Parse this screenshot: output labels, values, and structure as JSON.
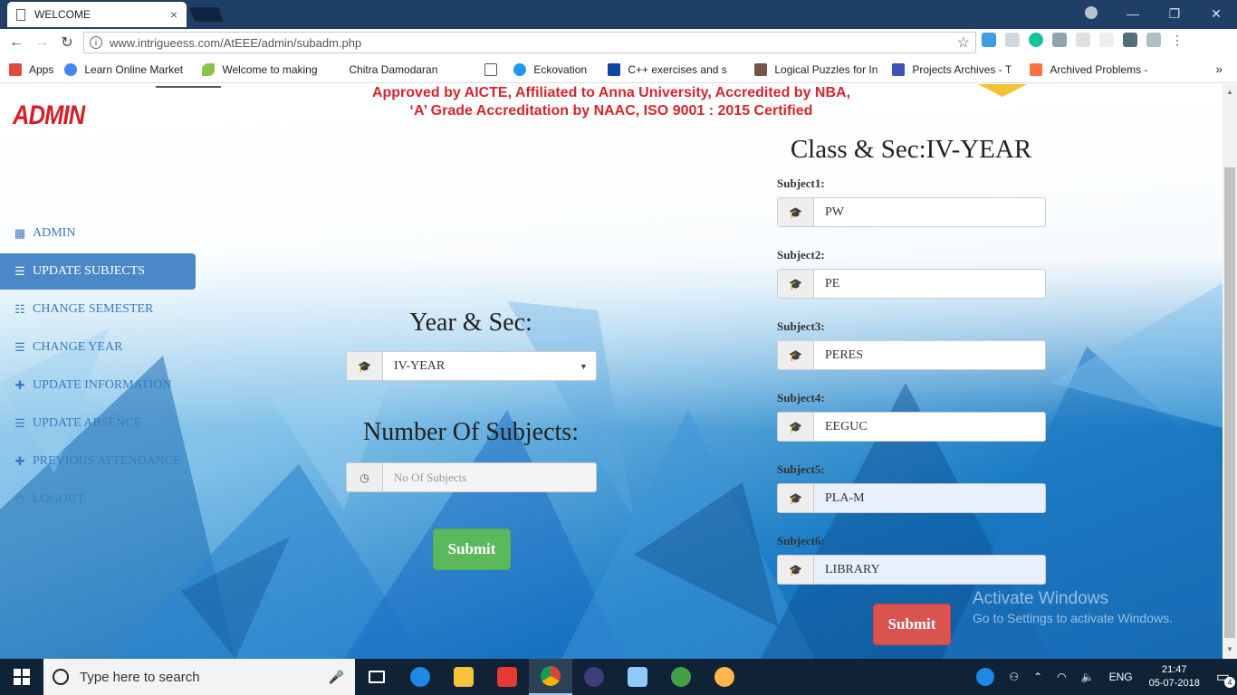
{
  "browser": {
    "tab_title": "WELCOME",
    "tab_close": "×",
    "url": "www.intrigueess.com/AtEEE/admin/subadm.php",
    "window_controls": [
      "—",
      "❐",
      "✕"
    ],
    "bookmarks_more": "»",
    "bookmarks": [
      {
        "label": "Apps",
        "color": "#e04a3a"
      },
      {
        "label": "Learn Online Market",
        "color": "#4285f4"
      },
      {
        "label": "Welcome to making",
        "color": "#8bc34a"
      },
      {
        "label": "Chitra Damodaran",
        "color": "#ffffff"
      },
      {
        "label": "",
        "color": "#ffffff"
      },
      {
        "label": "Eckovation",
        "color": "#2196f3"
      },
      {
        "label": "C++ exercises and s",
        "color": "#0d47a1"
      },
      {
        "label": "Logical Puzzles for In",
        "color": "#795548"
      },
      {
        "label": "Projects Archives - T",
        "color": "#3f51b5"
      },
      {
        "label": "Archived Problems -",
        "color": "#ff7043"
      }
    ]
  },
  "page": {
    "banner_line1": "Approved by AICTE, Affiliated to Anna University, Accredited by NBA,",
    "banner_line2": "‘A’ Grade Accreditation by NAAC, ISO 9001 : 2015 Certified",
    "admin_title": "ADMIN",
    "sidebar": [
      {
        "label": "ADMIN",
        "icon": "calendar-icon",
        "glyph": "▦",
        "active": false
      },
      {
        "label": "UPDATE SUBJECTS",
        "icon": "list-icon",
        "glyph": "☰",
        "active": true
      },
      {
        "label": "CHANGE SEMESTER",
        "icon": "list-icon",
        "glyph": "☷",
        "active": false
      },
      {
        "label": "CHANGE YEAR",
        "icon": "list-icon",
        "glyph": "☰",
        "active": false
      },
      {
        "label": "UPDATE INFORMATION",
        "icon": "plus-icon",
        "glyph": "✚",
        "active": false
      },
      {
        "label": "UPDATE ABSENCE",
        "icon": "list-icon",
        "glyph": "☰",
        "active": false
      },
      {
        "label": "PREVIOUS ATTENDANCE",
        "icon": "plus-icon",
        "glyph": "✚",
        "active": false
      },
      {
        "label": "LOGOUT",
        "icon": "power-icon",
        "glyph": "⏻",
        "active": false
      }
    ],
    "year_sec_label": "Year & Sec:",
    "year_sec_value": "IV-YEAR",
    "num_subjects_label": "Number Of Subjects:",
    "num_subjects_placeholder": "No Of Subjects",
    "submit_left": "Submit",
    "class_sec_title": "Class & Sec:IV-YEAR",
    "subjects": [
      {
        "label": "Subject1:",
        "value": "PW"
      },
      {
        "label": "Subject2:",
        "value": "PE"
      },
      {
        "label": "Subject3:",
        "value": "PERES"
      },
      {
        "label": "Subject4:",
        "value": "EEGUC"
      },
      {
        "label": "Subject5:",
        "value": "PLA-M"
      },
      {
        "label": "Subject6:",
        "value": "LIBRARY"
      }
    ],
    "submit_right": "Submit",
    "activate_line1": "Activate Windows",
    "activate_line2": "Go to Settings to activate Windows."
  },
  "taskbar": {
    "search_placeholder": "Type here to search",
    "lang": "ENG",
    "time": "21:47",
    "date": "05-07-2018",
    "notifications": "4"
  },
  "colors": {
    "accent": "#4a88c7",
    "admin_red": "#d51f25",
    "submit_green": "#5cb85c",
    "submit_red": "#d9534f"
  }
}
